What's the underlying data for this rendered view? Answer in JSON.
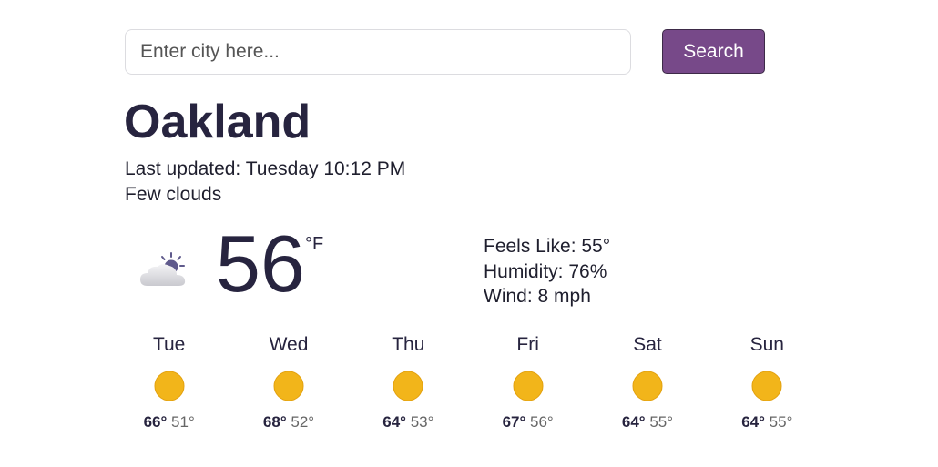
{
  "search": {
    "placeholder": "Enter city here...",
    "value": "",
    "button_label": "Search"
  },
  "city": "Oakland",
  "last_updated": "Last updated: Tuesday 10:12 PM",
  "condition": "Few clouds",
  "current": {
    "icon": "few-clouds-night-icon",
    "temperature": "56",
    "unit": "°F"
  },
  "details": {
    "feels_like": "Feels Like: 55°",
    "humidity": "Humidity: 76%",
    "wind": "Wind: 8 mph"
  },
  "forecast": [
    {
      "day": "Tue",
      "icon": "sun-icon",
      "high": "66°",
      "low": "51°"
    },
    {
      "day": "Wed",
      "icon": "sun-icon",
      "high": "68°",
      "low": "52°"
    },
    {
      "day": "Thu",
      "icon": "sun-icon",
      "high": "64°",
      "low": "53°"
    },
    {
      "day": "Fri",
      "icon": "sun-icon",
      "high": "67°",
      "low": "56°"
    },
    {
      "day": "Sat",
      "icon": "sun-icon",
      "high": "64°",
      "low": "55°"
    },
    {
      "day": "Sun",
      "icon": "sun-icon",
      "high": "64°",
      "low": "55°"
    }
  ],
  "colors": {
    "accent": "#774989",
    "heading": "#27243f",
    "sun": "#f2b51a"
  }
}
